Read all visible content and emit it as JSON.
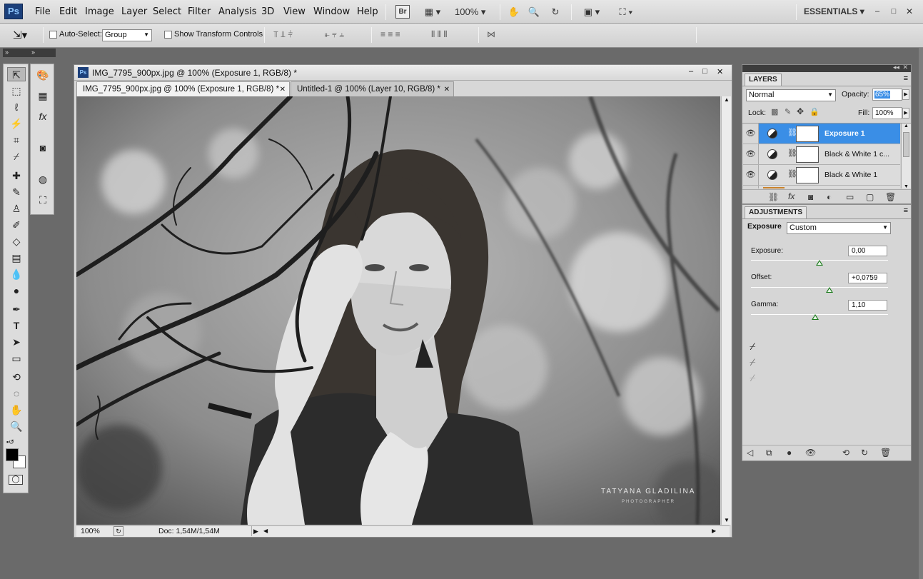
{
  "app": {
    "logo": "Ps",
    "workspace": "ESSENTIALS"
  },
  "menu": [
    "File",
    "Edit",
    "Image",
    "Layer",
    "Select",
    "Filter",
    "Analysis",
    "3D",
    "View",
    "Window",
    "Help"
  ],
  "appbar": {
    "bridge_label": "Br",
    "zoom": "100%"
  },
  "options": {
    "auto_select_label": "Auto-Select:",
    "auto_select_value": "Group",
    "show_transform_label": "Show Transform Controls"
  },
  "document": {
    "title": "IMG_7795_900px.jpg @ 100% (Exposure 1, RGB/8) *",
    "tabs": [
      {
        "label": "IMG_7795_900px.jpg @ 100% (Exposure 1, RGB/8) *"
      },
      {
        "label": "Untitled-1 @ 100% (Layer 10, RGB/8) *"
      }
    ],
    "watermark_name": "TATYANA GLADILINA",
    "watermark_sub": "PHOTOGRAPHER",
    "status_zoom": "100%",
    "status_doc": "Doc: 1,54M/1,54M"
  },
  "layers": {
    "tab": "LAYERS",
    "blend_mode": "Normal",
    "opacity_label": "Opacity:",
    "opacity_value": "65%",
    "lock_label": "Lock:",
    "fill_label": "Fill:",
    "fill_value": "100%",
    "items": [
      {
        "name": "Exposure 1",
        "selected": true
      },
      {
        "name": "Black & White 1 c..."
      },
      {
        "name": "Black & White 1"
      }
    ]
  },
  "adjustments": {
    "tab": "ADJUSTMENTS",
    "type_label": "Exposure",
    "preset": "Custom",
    "exposure_label": "Exposure:",
    "exposure_value": "0,00",
    "offset_label": "Offset:",
    "offset_value": "+0,0759",
    "gamma_label": "Gamma:",
    "gamma_value": "1,10"
  },
  "colors": {
    "selection": "#3a8ee6",
    "foreground": "#000000",
    "background": "#ffffff"
  }
}
